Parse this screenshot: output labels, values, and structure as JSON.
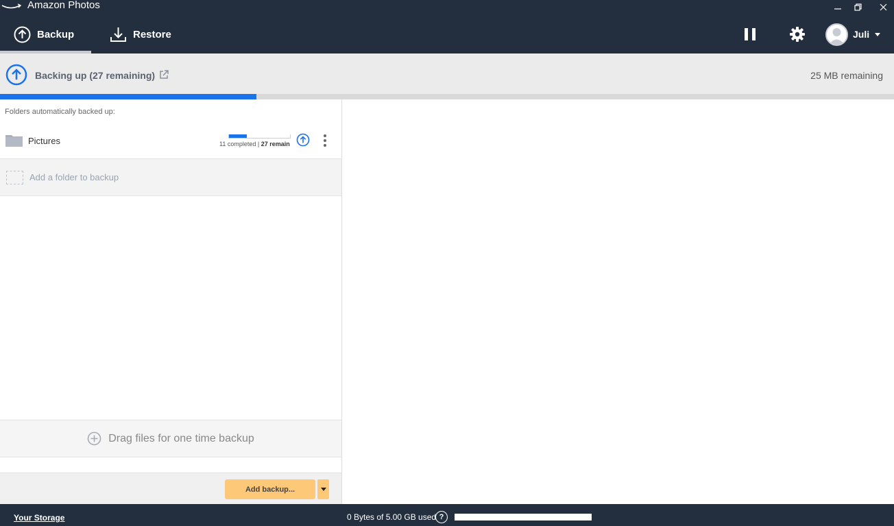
{
  "window": {
    "title": "Amazon Photos"
  },
  "nav": {
    "tabs": [
      {
        "label": "Backup",
        "active": true
      },
      {
        "label": "Restore",
        "active": false
      }
    ],
    "pause_icon": "pause-icon",
    "settings_icon": "gear-icon",
    "user": {
      "name": "Juli"
    }
  },
  "status": {
    "text": "Backing up (27 remaining)",
    "remaining_size": "25 MB remaining",
    "progress_fraction": 0.287
  },
  "folders": {
    "heading": "Folders automatically backed up:",
    "items": [
      {
        "name": "Pictures",
        "completed_text": "11 completed",
        "separator": "|",
        "remain_text": "27 remain",
        "progress_fraction": 0.289
      }
    ],
    "add_label": "Add a folder to backup"
  },
  "drag": {
    "label": "Drag files for one time backup"
  },
  "footer": {
    "add_backup_label": "Add backup..."
  },
  "storage": {
    "link_label": "Your Storage",
    "used_text": "0 Bytes of 5.00 GB used",
    "help_label": "?",
    "progress_fraction": 0.0
  },
  "colors": {
    "dark_bg": "#232f3e",
    "accent_blue": "#1a73e8",
    "button_orange": "#fec879"
  }
}
